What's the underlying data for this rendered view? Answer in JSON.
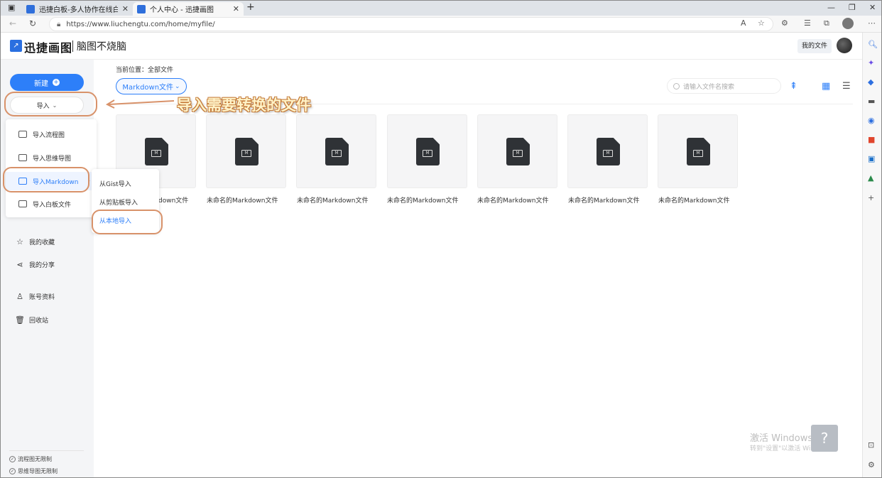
{
  "browser": {
    "tabs": [
      {
        "title": "迅捷白板-多人协作在线白板工具"
      },
      {
        "title": "个人中心 - 迅捷画图"
      }
    ],
    "url": "https://www.liuchengtu.com/home/myfile/"
  },
  "header": {
    "logo_text": "迅捷画图",
    "slogan": "脑图不烧脑",
    "my_files_label": "我的文件"
  },
  "sidebar": {
    "new_label": "新建",
    "import_label": "导入",
    "import_menu": [
      {
        "label": "导入流程图"
      },
      {
        "label": "导入思维导图"
      },
      {
        "label": "导入Markdown"
      },
      {
        "label": "导入白板文件"
      }
    ],
    "links": [
      {
        "label": "我的收藏",
        "icon": "star-icon"
      },
      {
        "label": "我的分享",
        "icon": "share-icon"
      },
      {
        "label": "账号资料",
        "icon": "user-icon"
      },
      {
        "label": "回收站",
        "icon": "trash-icon"
      }
    ],
    "quotas": [
      "流程图无限制",
      "思维导图无限制"
    ]
  },
  "submenu": {
    "items": [
      {
        "label": "从Gist导入"
      },
      {
        "label": "从剪贴板导入"
      },
      {
        "label": "从本地导入"
      }
    ]
  },
  "main": {
    "breadcrumb": "当前位置：全部文件",
    "filter_label": "Markdown文件",
    "search_placeholder": "请输入文件名搜索",
    "annotation": "导入需要转换的文件",
    "files": [
      {
        "name": "未命名的Markdown文件"
      },
      {
        "name": "未命名的Markdown文件"
      },
      {
        "name": "未命名的Markdown文件"
      },
      {
        "name": "未命名的Markdown文件"
      },
      {
        "name": "未命名的Markdown文件"
      },
      {
        "name": "未命名的Markdown文件"
      },
      {
        "name": "未命名的Markdown文件"
      }
    ],
    "first_file_visible_text": "down文件"
  },
  "watermark": {
    "line1": "激活 Windows",
    "line2": "转到\"设置\"以激活 Windows。"
  },
  "colors": {
    "accent": "#2d7ff9",
    "annotation_ring": "#d8926a"
  }
}
